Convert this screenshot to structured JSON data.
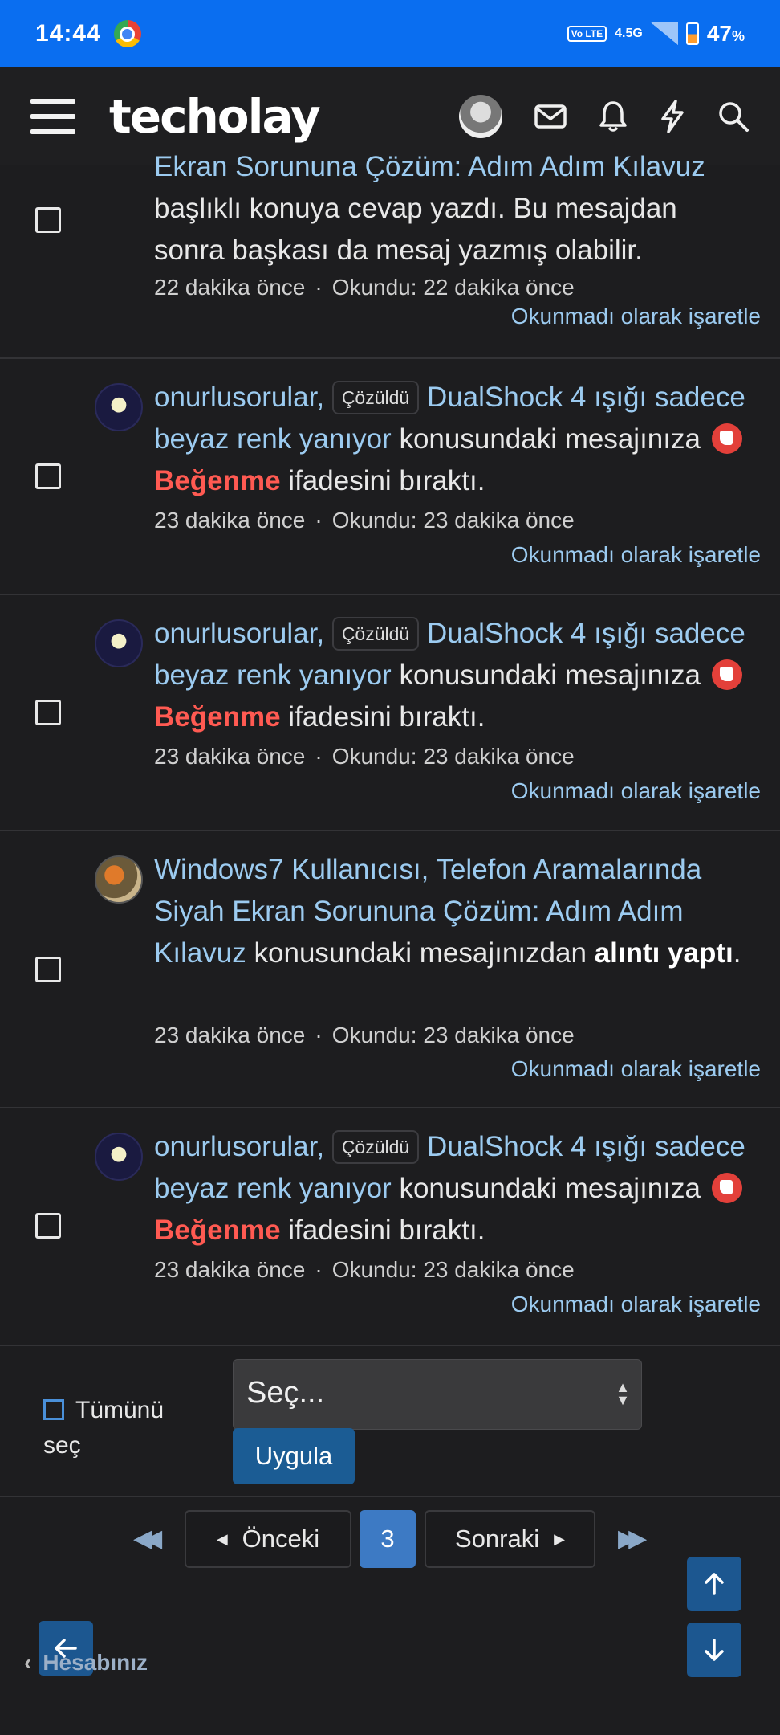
{
  "status_bar": {
    "time": "14:44",
    "network_top": "4.5G",
    "volte": "Vo LTE",
    "battery_value": "47",
    "battery_unit": "%"
  },
  "header": {
    "logo": "techolay"
  },
  "notifications": [
    {
      "partial_title": "Ekran Sorununa Çözüm: Adım Adım Kılavuz",
      "text_after": "başlıklı konuya cevap yazdı. Bu mesajdan sonra başkası da mesaj yazmış olabilir.",
      "time": "22 dakika önce",
      "read": "Okundu: 22 dakika önce",
      "mark_unread": "Okunmadı olarak işaretle"
    },
    {
      "user": "onurlusorular,",
      "badge": "Çözüldü",
      "thread": "DualShock 4 ışığı sadece beyaz renk yanıyor",
      "text_mid": "konusundaki mesajınıza",
      "reaction": "Beğenme",
      "text_end": "ifadesini bıraktı.",
      "time": "23 dakika önce",
      "read": "Okundu: 23 dakika önce",
      "mark_unread": "Okunmadı olarak işaretle"
    },
    {
      "user": "onurlusorular,",
      "badge": "Çözüldü",
      "thread": "DualShock 4 ışığı sadece beyaz renk yanıyor",
      "text_mid": "konusundaki mesajınıza",
      "reaction": "Beğenme",
      "text_end": "ifadesini bıraktı.",
      "time": "23 dakika önce",
      "read": "Okundu: 23 dakika önce",
      "mark_unread": "Okunmadı olarak işaretle"
    },
    {
      "user": "Windows7 Kullanıcısı,",
      "thread": "Telefon Aramalarında Siyah Ekran Sorununa Çözüm: Adım Adım Kılavuz",
      "text_mid": "konusundaki mesajınızdan",
      "action": "alıntı yaptı",
      "text_end": ".",
      "time": "23 dakika önce",
      "read": "Okundu: 23 dakika önce",
      "mark_unread": "Okunmadı olarak işaretle"
    },
    {
      "user": "onurlusorular,",
      "badge": "Çözüldü",
      "thread": "DualShock 4 ışığı sadece beyaz renk yanıyor",
      "text_mid": "konusundaki mesajınıza",
      "reaction": "Beğenme",
      "text_end": "ifadesini bıraktı.",
      "time": "23 dakika önce",
      "read": "Okundu: 23 dakika önce",
      "mark_unread": "Okunmadı olarak işaretle"
    }
  ],
  "form": {
    "select_all": "Tümünü seç",
    "select_placeholder": "Seç...",
    "apply": "Uygula"
  },
  "pager": {
    "prev": "Önceki",
    "current": "3",
    "next": "Sonraki"
  },
  "footer": {
    "account": "Hesabınız"
  },
  "colors": {
    "accent": "#1b5c94",
    "link": "#9ccbf0",
    "reaction": "#ff5a52",
    "status_bar": "#0a6ef0"
  }
}
